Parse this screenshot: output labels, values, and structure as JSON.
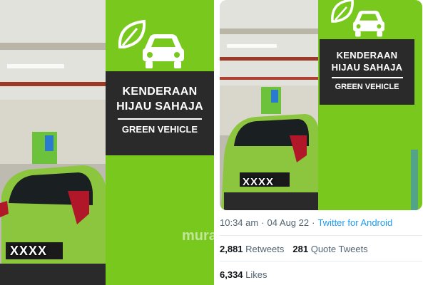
{
  "left_photo": {
    "sign": {
      "line1": "KENDERAAN",
      "line2": "HIJAU SAHAJA",
      "line3": "GREEN VEHICLE"
    },
    "plate": "XXXX",
    "watermark": "murai"
  },
  "right_photo": {
    "sign": {
      "line1": "KENDERAAN",
      "line2": "HIJAU SAHAJA",
      "line3": "GREEN VEHICLE"
    },
    "plate": "XXXX"
  },
  "tweet": {
    "time": "10:34 am",
    "separator": "·",
    "date": "04 Aug 22",
    "source": "Twitter for Android",
    "retweets_count": "2,881",
    "retweets_label": "Retweets",
    "quote_count": "281",
    "quote_label": "Quote Tweets",
    "likes_count": "6,334",
    "likes_label": "Likes"
  },
  "colors": {
    "pillar_green": "#78c81e",
    "car_green": "#8cc63e",
    "sign_bg": "#2a2a2a",
    "twitter_blue": "#1d9bf0",
    "meta_gray": "#536471"
  },
  "icons": [
    "leaf-icon",
    "car-icon"
  ]
}
